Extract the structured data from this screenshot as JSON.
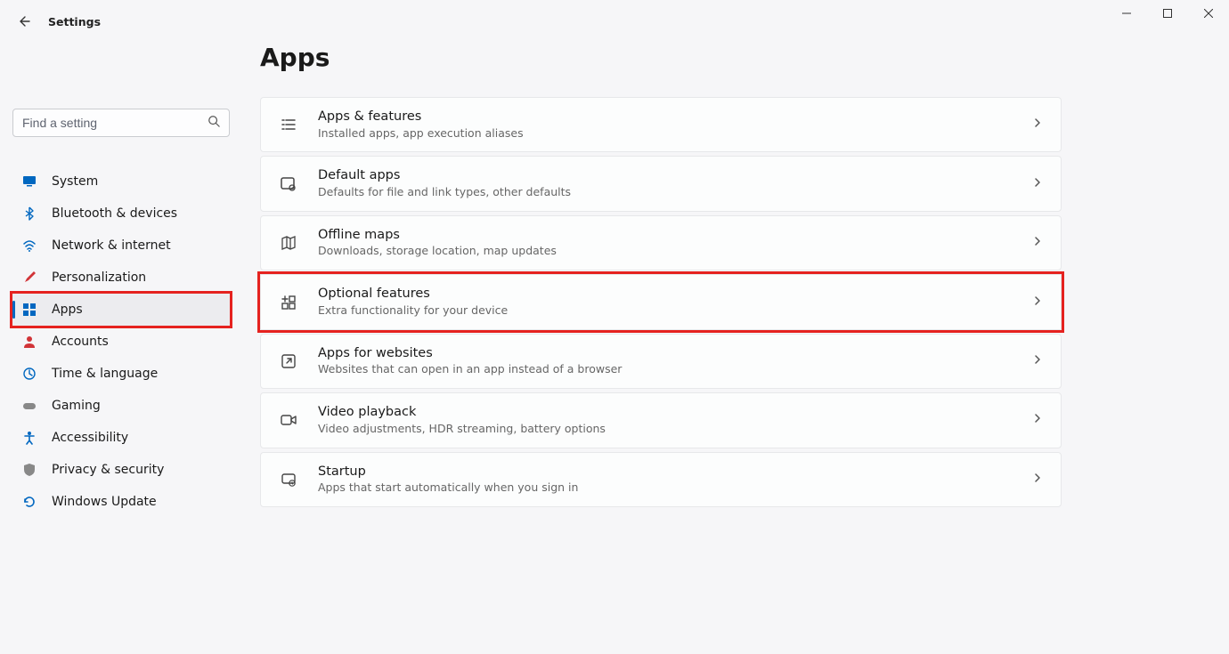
{
  "window": {
    "title": "Settings",
    "minimize": "–",
    "maximize": "◻",
    "close": "✕"
  },
  "search": {
    "placeholder": "Find a setting"
  },
  "sidebar": {
    "items": [
      {
        "label": "System",
        "icon_color": "#0067c0"
      },
      {
        "label": "Bluetooth & devices",
        "icon_color": "#0067c0"
      },
      {
        "label": "Network & internet",
        "icon_color": "#0067c0"
      },
      {
        "label": "Personalization",
        "icon_color": "#d13438"
      },
      {
        "label": "Apps",
        "icon_color": "#0067c0"
      },
      {
        "label": "Accounts",
        "icon_color": "#d13438"
      },
      {
        "label": "Time & language",
        "icon_color": "#0067c0"
      },
      {
        "label": "Gaming",
        "icon_color": "#777"
      },
      {
        "label": "Accessibility",
        "icon_color": "#0067c0"
      },
      {
        "label": "Privacy & security",
        "icon_color": "#777"
      },
      {
        "label": "Windows Update",
        "icon_color": "#0067c0"
      }
    ]
  },
  "page": {
    "title": "Apps"
  },
  "cards": [
    {
      "title": "Apps & features",
      "sub": "Installed apps, app execution aliases"
    },
    {
      "title": "Default apps",
      "sub": "Defaults for file and link types, other defaults"
    },
    {
      "title": "Offline maps",
      "sub": "Downloads, storage location, map updates"
    },
    {
      "title": "Optional features",
      "sub": "Extra functionality for your device"
    },
    {
      "title": "Apps for websites",
      "sub": "Websites that can open in an app instead of a browser"
    },
    {
      "title": "Video playback",
      "sub": "Video adjustments, HDR streaming, battery options"
    },
    {
      "title": "Startup",
      "sub": "Apps that start automatically when you sign in"
    }
  ]
}
